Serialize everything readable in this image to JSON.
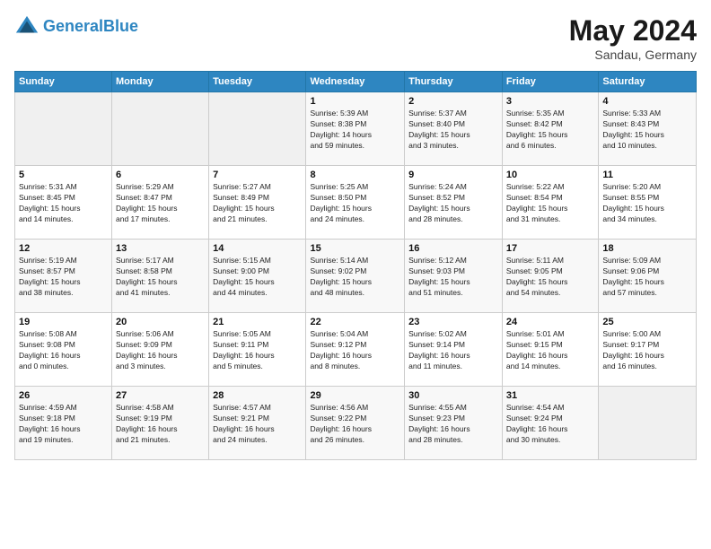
{
  "header": {
    "logo_line1": "General",
    "logo_line2": "Blue",
    "month": "May 2024",
    "location": "Sandau, Germany"
  },
  "days_of_week": [
    "Sunday",
    "Monday",
    "Tuesday",
    "Wednesday",
    "Thursday",
    "Friday",
    "Saturday"
  ],
  "weeks": [
    [
      {
        "day": "",
        "info": ""
      },
      {
        "day": "",
        "info": ""
      },
      {
        "day": "",
        "info": ""
      },
      {
        "day": "1",
        "info": "Sunrise: 5:39 AM\nSunset: 8:38 PM\nDaylight: 14 hours\nand 59 minutes."
      },
      {
        "day": "2",
        "info": "Sunrise: 5:37 AM\nSunset: 8:40 PM\nDaylight: 15 hours\nand 3 minutes."
      },
      {
        "day": "3",
        "info": "Sunrise: 5:35 AM\nSunset: 8:42 PM\nDaylight: 15 hours\nand 6 minutes."
      },
      {
        "day": "4",
        "info": "Sunrise: 5:33 AM\nSunset: 8:43 PM\nDaylight: 15 hours\nand 10 minutes."
      }
    ],
    [
      {
        "day": "5",
        "info": "Sunrise: 5:31 AM\nSunset: 8:45 PM\nDaylight: 15 hours\nand 14 minutes."
      },
      {
        "day": "6",
        "info": "Sunrise: 5:29 AM\nSunset: 8:47 PM\nDaylight: 15 hours\nand 17 minutes."
      },
      {
        "day": "7",
        "info": "Sunrise: 5:27 AM\nSunset: 8:49 PM\nDaylight: 15 hours\nand 21 minutes."
      },
      {
        "day": "8",
        "info": "Sunrise: 5:25 AM\nSunset: 8:50 PM\nDaylight: 15 hours\nand 24 minutes."
      },
      {
        "day": "9",
        "info": "Sunrise: 5:24 AM\nSunset: 8:52 PM\nDaylight: 15 hours\nand 28 minutes."
      },
      {
        "day": "10",
        "info": "Sunrise: 5:22 AM\nSunset: 8:54 PM\nDaylight: 15 hours\nand 31 minutes."
      },
      {
        "day": "11",
        "info": "Sunrise: 5:20 AM\nSunset: 8:55 PM\nDaylight: 15 hours\nand 34 minutes."
      }
    ],
    [
      {
        "day": "12",
        "info": "Sunrise: 5:19 AM\nSunset: 8:57 PM\nDaylight: 15 hours\nand 38 minutes."
      },
      {
        "day": "13",
        "info": "Sunrise: 5:17 AM\nSunset: 8:58 PM\nDaylight: 15 hours\nand 41 minutes."
      },
      {
        "day": "14",
        "info": "Sunrise: 5:15 AM\nSunset: 9:00 PM\nDaylight: 15 hours\nand 44 minutes."
      },
      {
        "day": "15",
        "info": "Sunrise: 5:14 AM\nSunset: 9:02 PM\nDaylight: 15 hours\nand 48 minutes."
      },
      {
        "day": "16",
        "info": "Sunrise: 5:12 AM\nSunset: 9:03 PM\nDaylight: 15 hours\nand 51 minutes."
      },
      {
        "day": "17",
        "info": "Sunrise: 5:11 AM\nSunset: 9:05 PM\nDaylight: 15 hours\nand 54 minutes."
      },
      {
        "day": "18",
        "info": "Sunrise: 5:09 AM\nSunset: 9:06 PM\nDaylight: 15 hours\nand 57 minutes."
      }
    ],
    [
      {
        "day": "19",
        "info": "Sunrise: 5:08 AM\nSunset: 9:08 PM\nDaylight: 16 hours\nand 0 minutes."
      },
      {
        "day": "20",
        "info": "Sunrise: 5:06 AM\nSunset: 9:09 PM\nDaylight: 16 hours\nand 3 minutes."
      },
      {
        "day": "21",
        "info": "Sunrise: 5:05 AM\nSunset: 9:11 PM\nDaylight: 16 hours\nand 5 minutes."
      },
      {
        "day": "22",
        "info": "Sunrise: 5:04 AM\nSunset: 9:12 PM\nDaylight: 16 hours\nand 8 minutes."
      },
      {
        "day": "23",
        "info": "Sunrise: 5:02 AM\nSunset: 9:14 PM\nDaylight: 16 hours\nand 11 minutes."
      },
      {
        "day": "24",
        "info": "Sunrise: 5:01 AM\nSunset: 9:15 PM\nDaylight: 16 hours\nand 14 minutes."
      },
      {
        "day": "25",
        "info": "Sunrise: 5:00 AM\nSunset: 9:17 PM\nDaylight: 16 hours\nand 16 minutes."
      }
    ],
    [
      {
        "day": "26",
        "info": "Sunrise: 4:59 AM\nSunset: 9:18 PM\nDaylight: 16 hours\nand 19 minutes."
      },
      {
        "day": "27",
        "info": "Sunrise: 4:58 AM\nSunset: 9:19 PM\nDaylight: 16 hours\nand 21 minutes."
      },
      {
        "day": "28",
        "info": "Sunrise: 4:57 AM\nSunset: 9:21 PM\nDaylight: 16 hours\nand 24 minutes."
      },
      {
        "day": "29",
        "info": "Sunrise: 4:56 AM\nSunset: 9:22 PM\nDaylight: 16 hours\nand 26 minutes."
      },
      {
        "day": "30",
        "info": "Sunrise: 4:55 AM\nSunset: 9:23 PM\nDaylight: 16 hours\nand 28 minutes."
      },
      {
        "day": "31",
        "info": "Sunrise: 4:54 AM\nSunset: 9:24 PM\nDaylight: 16 hours\nand 30 minutes."
      },
      {
        "day": "",
        "info": ""
      }
    ]
  ]
}
